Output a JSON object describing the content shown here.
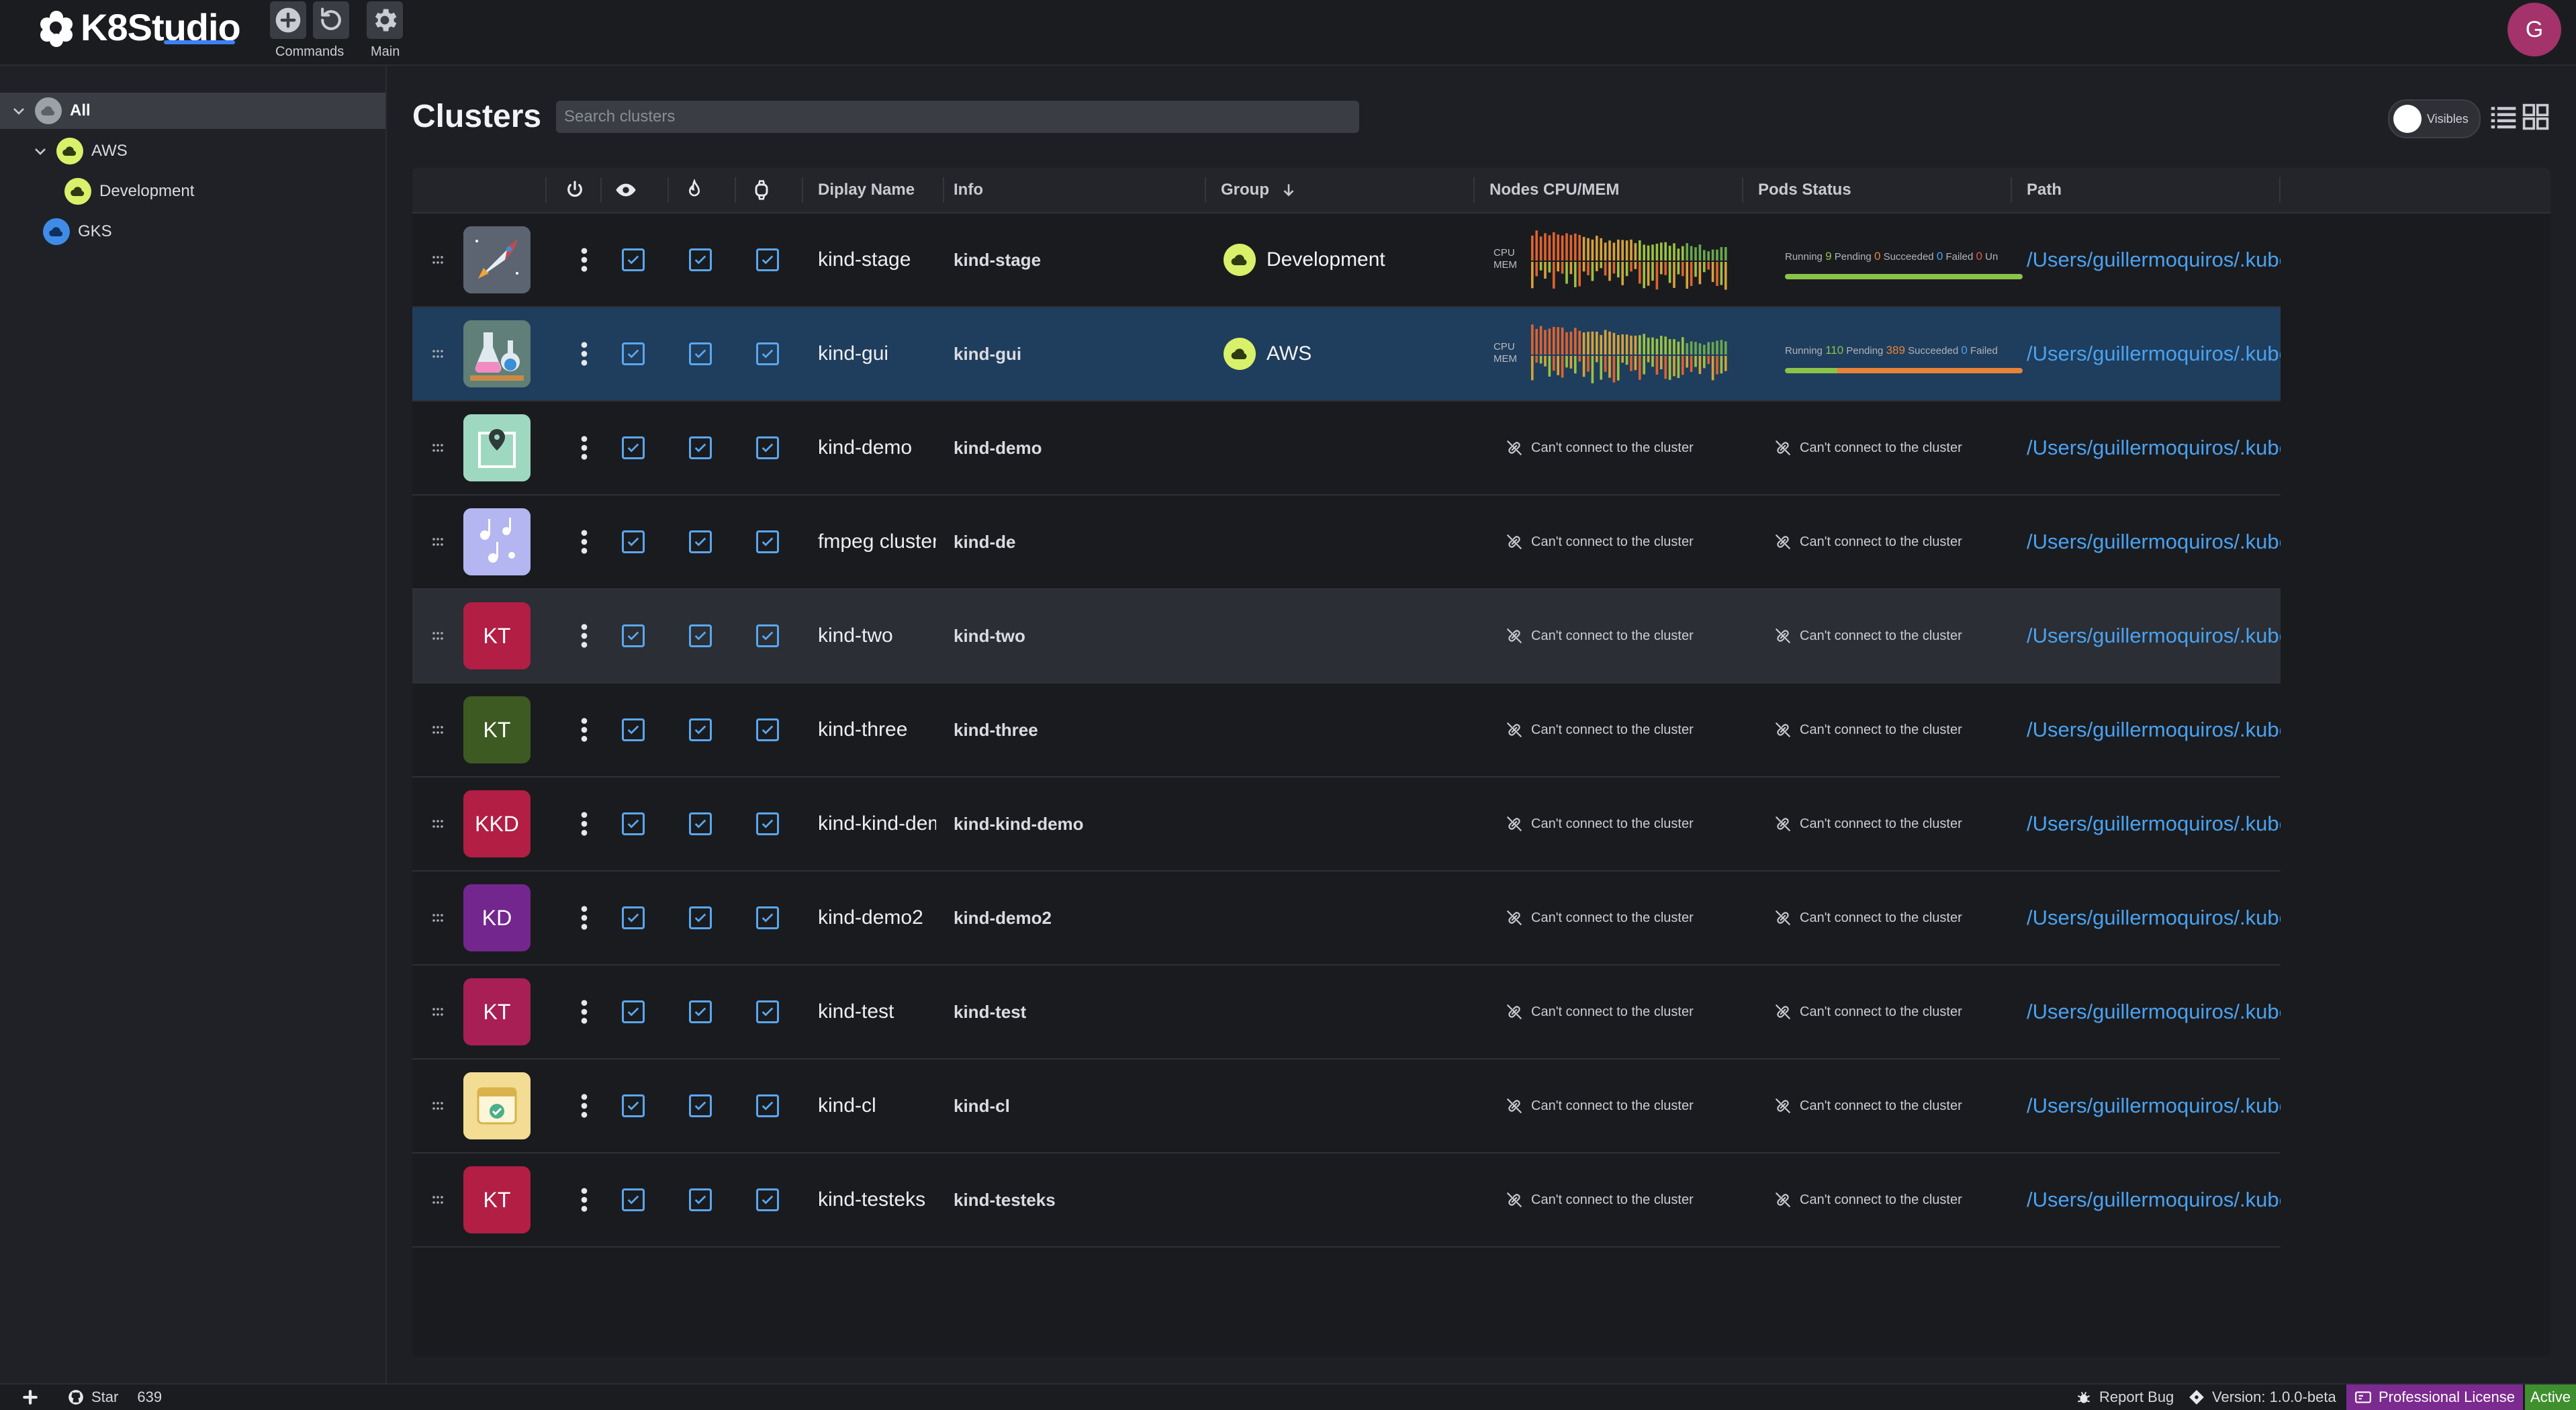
{
  "app": {
    "logo_text": "K8Studio",
    "header_buttons": [
      {
        "name": "add",
        "icon": "plus-circle-icon"
      },
      {
        "name": "refresh",
        "icon": "refresh-icon"
      },
      {
        "name": "settings",
        "icon": "gear-icon"
      }
    ],
    "commands_label": "Commands",
    "main_label": "Main",
    "avatar_initial": "G"
  },
  "sidebar": {
    "items": [
      {
        "label": "All",
        "level": 0,
        "selected": true,
        "expanded": true,
        "color": "#9ca0a8"
      },
      {
        "label": "AWS",
        "level": 1,
        "expanded": true,
        "color": "#d9f06a"
      },
      {
        "label": "Development",
        "level": 2,
        "color": "#d9f06a"
      },
      {
        "label": "GKS",
        "level": 1,
        "color": "#3f8ce8"
      }
    ]
  },
  "main": {
    "title": "Clusters",
    "search_placeholder": "Search clusters",
    "visibles_label": "Visibles",
    "columns": {
      "display_name": "Diplay Name",
      "info": "Info",
      "group": "Group",
      "nodes": "Nodes CPU/MEM",
      "pods": "Pods Status",
      "path": "Path"
    }
  },
  "labels": {
    "cant_connect": "Can't connect to the cluster",
    "cpu": "CPU",
    "mem": "MEM",
    "running": "Running",
    "pending": "Pending",
    "succeeded": "Succeeded",
    "failed": "Failed",
    "unknown_short": "Un"
  },
  "clusters": [
    {
      "display_name": "kind-stage",
      "info": "kind-stage",
      "group": "Development",
      "icon": "rocket-image",
      "icon_bg": "#5b6470",
      "initials": "",
      "connected": true,
      "pods": {
        "running": 9,
        "pending": 0,
        "succeeded": 0,
        "failed": 0,
        "running_pct": 100,
        "pending_pct": 0
      },
      "path": "/Users/guillermoquiros/.kube/config"
    },
    {
      "display_name": "kind-gui",
      "info": "kind-gui",
      "group": "AWS",
      "icon": "flask-image",
      "icon_bg": "#5f7f78",
      "initials": "",
      "connected": true,
      "pods": {
        "running": 110,
        "pending": 389,
        "succeeded": 0,
        "failed": null,
        "running_pct": 22,
        "pending_pct": 78
      },
      "path": "/Users/guillermoquiros/.kube/config"
    },
    {
      "display_name": "kind-demo",
      "info": "kind-demo",
      "group": "",
      "icon": "map-pin-image",
      "icon_bg": "#9fd8c0",
      "initials": "",
      "connected": false,
      "path": "/Users/guillermoquiros/.kube/config"
    },
    {
      "display_name": "fmpeg cluster",
      "info": "kind-de",
      "group": "",
      "icon": "music-image",
      "icon_bg": "#b3b6f0",
      "initials": "",
      "connected": false,
      "path": "/Users/guillermoquiros/.kube/config"
    },
    {
      "display_name": "kind-two",
      "info": "kind-two",
      "group": "",
      "icon": "",
      "icon_bg": "#b21e44",
      "initials": "KT",
      "connected": false,
      "path": "/Users/guillermoquiros/.kube/config"
    },
    {
      "display_name": "kind-three",
      "info": "kind-three",
      "group": "",
      "icon": "",
      "icon_bg": "#3d5a22",
      "initials": "KT",
      "connected": false,
      "path": "/Users/guillermoquiros/.kube/config"
    },
    {
      "display_name": "kind-kind-demo",
      "info": "kind-kind-demo",
      "group": "",
      "icon": "",
      "icon_bg": "#b21e44",
      "initials": "KKD",
      "connected": false,
      "path": "/Users/guillermoquiros/.kube/config"
    },
    {
      "display_name": "kind-demo2",
      "info": "kind-demo2",
      "group": "",
      "icon": "",
      "icon_bg": "#74268f",
      "initials": "KD",
      "connected": false,
      "path": "/Users/guillermoquiros/.kube/config"
    },
    {
      "display_name": "kind-test",
      "info": "kind-test",
      "group": "",
      "icon": "",
      "icon_bg": "#a71f55",
      "initials": "KT",
      "connected": false,
      "path": "/Users/guillermoquiros/.kube/config"
    },
    {
      "display_name": "kind-cl",
      "info": "kind-cl",
      "group": "",
      "icon": "calendar-image",
      "icon_bg": "#f3dc93",
      "initials": "",
      "connected": false,
      "path": "/Users/guillermoquiros/.kube/config"
    },
    {
      "display_name": "kind-testeks",
      "info": "kind-testeks",
      "group": "",
      "icon": "",
      "icon_bg": "#b21e44",
      "initials": "KT",
      "connected": false,
      "path": "/Users/guillermoquiros/.kube/config"
    }
  ],
  "footer": {
    "star_label": "Star",
    "star_count": "639",
    "report_bug": "Report Bug",
    "version": "Version: 1.0.0-beta",
    "license": "Professional License",
    "license_status": "Active"
  },
  "colors": {
    "accent": "#4aa2f0",
    "selected_row": "#1f3d5c",
    "running": "#8bc34a",
    "pending": "#e8833a",
    "license_bg": "#7b2a8f",
    "active_bg": "#3f8f2f"
  }
}
